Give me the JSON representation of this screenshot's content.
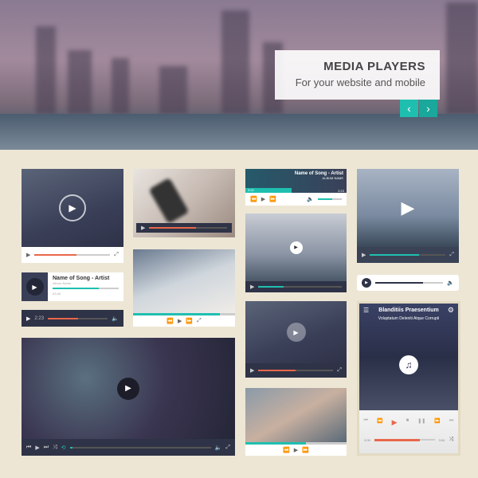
{
  "hero": {
    "title": "MEDIA PLAYERS",
    "subtitle": "For your website and mobile",
    "prev": "‹",
    "next": "›"
  },
  "colors": {
    "accent": "#1fbfb0",
    "progress": "#e8674a",
    "dark": "#2f3347",
    "background": "#ede6d5"
  },
  "players": {
    "mini_audio": {
      "song": "Name of Song - Artist",
      "album": "ALBUM NAME",
      "elapsed": "3:22",
      "total": "2:23"
    },
    "music_card": {
      "song": "Name of Song - Artist",
      "album": "Album Name",
      "time": "03:46"
    },
    "audio_bar": {
      "time": "2:23"
    },
    "mobile": {
      "title": "Blanditiis Praesentium",
      "subtitle": "Voluptatum Deleniti Atque Corrupti",
      "elapsed": "3:05",
      "total": "3:54"
    }
  },
  "icons": {
    "play": "▶",
    "pause": "❚❚",
    "stop": "■",
    "prev": "⏮",
    "next": "⏭",
    "rew": "⏪",
    "ff": "⏩",
    "volume": "🔈",
    "fullscreen": "⤢",
    "shuffle": "⤨",
    "repeat": "⟲",
    "menu": "☰",
    "settings": "⚙",
    "music": "♫"
  }
}
